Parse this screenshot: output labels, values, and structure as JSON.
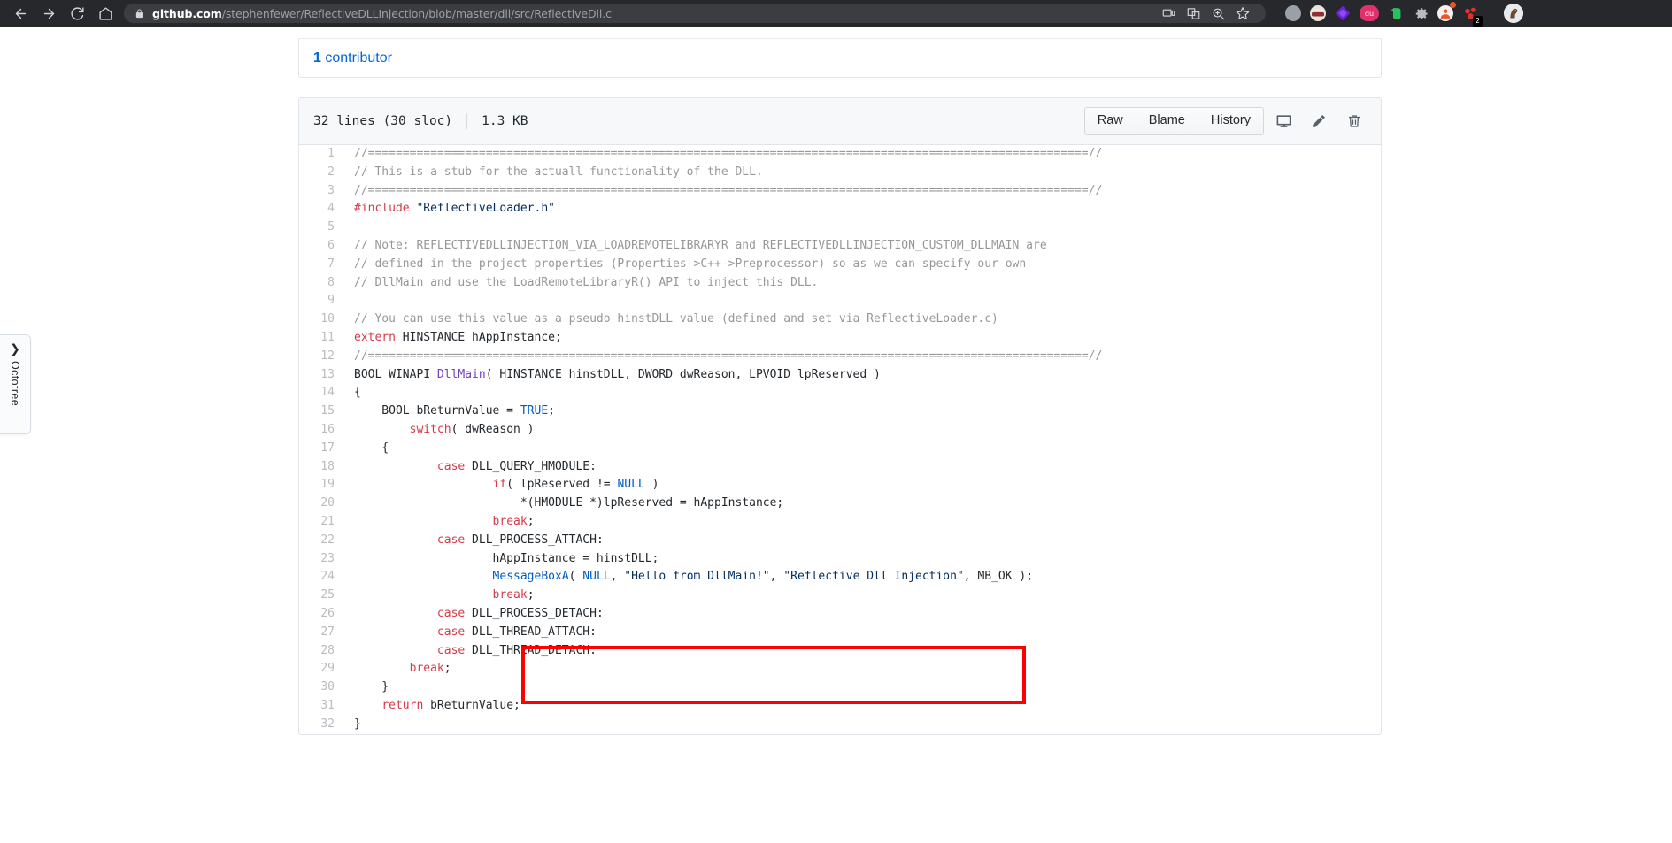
{
  "browser": {
    "nav": {
      "back": "back-arrow",
      "forward": "forward-arrow",
      "reload": "reload",
      "home": "home"
    },
    "omnibox": {
      "lock": "secure-lock",
      "host": "github.com",
      "path": "/stephenfewer/ReflectiveDLLInjection/blob/master/dll/src/ReflectiveDll.c",
      "full_url": "github.com/stephenfewer/ReflectiveDLLInjection/blob/master/dll/src/ReflectiveDll.c"
    },
    "omni_icons": [
      "cast-icon",
      "translate-icon",
      "zoom-icon",
      "bookmark-star-icon"
    ],
    "extensions": [
      {
        "name": "grey-circle-extension",
        "color": "#9aa0a6",
        "glyph": "○"
      },
      {
        "name": "incognito-mask-extension",
        "color": "#8b2d2d",
        "glyph": "◑"
      },
      {
        "name": "purple-diamond-extension",
        "color": "#7d2ae8",
        "glyph": "◆"
      },
      {
        "name": "du-pill-extension",
        "color": "#e2306c",
        "glyph": "du"
      },
      {
        "name": "evernote-extension",
        "color": "#2dbe60",
        "glyph": "◠"
      },
      {
        "name": "gear-extension",
        "color": "#8a8f94",
        "glyph": "⚙"
      },
      {
        "name": "contacts-extension",
        "color": "#e86a33",
        "glyph": "⚑",
        "badge": ""
      },
      {
        "name": "red-dots-extension",
        "color": "#d9342b",
        "glyph": "⁘",
        "badge": "2"
      }
    ],
    "profile_avatar": "horse-avatar"
  },
  "octotree": {
    "label": "Octotree",
    "chevron": "chevron-right-icon"
  },
  "contributors": {
    "count": "1",
    "label": " contributor"
  },
  "file": {
    "lines_info": "32 lines (30 sloc)",
    "size": "1.3 KB",
    "buttons": [
      "Raw",
      "Blame",
      "History"
    ],
    "icons": [
      "desktop-icon",
      "pencil-edit-icon",
      "trash-delete-icon"
    ]
  },
  "code": {
    "lines": [
      {
        "n": "1",
        "tokens": [
          {
            "t": "//========================================================================================================//",
            "c": "c"
          }
        ]
      },
      {
        "n": "2",
        "tokens": [
          {
            "t": "// This is a stub for the actuall functionality of the DLL.",
            "c": "c"
          }
        ]
      },
      {
        "n": "3",
        "tokens": [
          {
            "t": "//========================================================================================================//",
            "c": "c"
          }
        ]
      },
      {
        "n": "4",
        "tokens": [
          {
            "t": "#include",
            "c": "k"
          },
          {
            "t": " ",
            "c": ""
          },
          {
            "t": "\"ReflectiveLoader.h\"",
            "c": "s"
          }
        ]
      },
      {
        "n": "5",
        "tokens": [
          {
            "t": "",
            "c": ""
          }
        ]
      },
      {
        "n": "6",
        "tokens": [
          {
            "t": "// Note: REFLECTIVEDLLINJECTION_VIA_LOADREMOTELIBRARYR and REFLECTIVEDLLINJECTION_CUSTOM_DLLMAIN are",
            "c": "c"
          }
        ]
      },
      {
        "n": "7",
        "tokens": [
          {
            "t": "// defined in the project properties (Properties->C++->Preprocessor) so as we can specify our own",
            "c": "c"
          }
        ]
      },
      {
        "n": "8",
        "tokens": [
          {
            "t": "// DllMain and use the LoadRemoteLibraryR() API to inject this DLL.",
            "c": "c"
          }
        ]
      },
      {
        "n": "9",
        "tokens": [
          {
            "t": "",
            "c": ""
          }
        ]
      },
      {
        "n": "10",
        "tokens": [
          {
            "t": "// You can use this value as a pseudo hinstDLL value (defined and set via ReflectiveLoader.c)",
            "c": "c"
          }
        ]
      },
      {
        "n": "11",
        "tokens": [
          {
            "t": "extern",
            "c": "k"
          },
          {
            "t": " HINSTANCE hAppInstance;",
            "c": ""
          }
        ]
      },
      {
        "n": "12",
        "tokens": [
          {
            "t": "//========================================================================================================//",
            "c": "c"
          }
        ]
      },
      {
        "n": "13",
        "tokens": [
          {
            "t": "BOOL WINAPI ",
            "c": ""
          },
          {
            "t": "DllMain",
            "c": "fn"
          },
          {
            "t": "( HINSTANCE hinstDLL, DWORD dwReason, LPVOID lpReserved )",
            "c": ""
          }
        ]
      },
      {
        "n": "14",
        "tokens": [
          {
            "t": "{",
            "c": ""
          }
        ]
      },
      {
        "n": "15",
        "tokens": [
          {
            "t": "    BOOL bReturnValue = ",
            "c": ""
          },
          {
            "t": "TRUE",
            "c": "cn"
          },
          {
            "t": ";",
            "c": ""
          }
        ]
      },
      {
        "n": "16",
        "tokens": [
          {
            "t": "        ",
            "c": ""
          },
          {
            "t": "switch",
            "c": "k"
          },
          {
            "t": "( dwReason )",
            "c": ""
          }
        ]
      },
      {
        "n": "17",
        "tokens": [
          {
            "t": "    {",
            "c": ""
          }
        ]
      },
      {
        "n": "18",
        "tokens": [
          {
            "t": "            ",
            "c": ""
          },
          {
            "t": "case",
            "c": "k"
          },
          {
            "t": " DLL_QUERY_HMODULE:",
            "c": ""
          }
        ]
      },
      {
        "n": "19",
        "tokens": [
          {
            "t": "                    ",
            "c": ""
          },
          {
            "t": "if",
            "c": "k"
          },
          {
            "t": "( lpReserved != ",
            "c": ""
          },
          {
            "t": "NULL",
            "c": "cn"
          },
          {
            "t": " )",
            "c": ""
          }
        ]
      },
      {
        "n": "20",
        "tokens": [
          {
            "t": "                        *(HMODULE *)lpReserved = hAppInstance;",
            "c": ""
          }
        ]
      },
      {
        "n": "21",
        "tokens": [
          {
            "t": "                    ",
            "c": ""
          },
          {
            "t": "break",
            "c": "k"
          },
          {
            "t": ";",
            "c": ""
          }
        ]
      },
      {
        "n": "22",
        "tokens": [
          {
            "t": "            ",
            "c": ""
          },
          {
            "t": "case",
            "c": "k"
          },
          {
            "t": " DLL_PROCESS_ATTACH:",
            "c": ""
          }
        ]
      },
      {
        "n": "23",
        "tokens": [
          {
            "t": "                    hAppInstance = hinstDLL;",
            "c": ""
          }
        ]
      },
      {
        "n": "24",
        "tokens": [
          {
            "t": "                    ",
            "c": ""
          },
          {
            "t": "MessageBoxA",
            "c": "bl"
          },
          {
            "t": "( ",
            "c": ""
          },
          {
            "t": "NULL",
            "c": "cn"
          },
          {
            "t": ", ",
            "c": ""
          },
          {
            "t": "\"Hello from DllMain!\"",
            "c": "s"
          },
          {
            "t": ", ",
            "c": ""
          },
          {
            "t": "\"Reflective Dll Injection\"",
            "c": "s"
          },
          {
            "t": ", MB_OK );",
            "c": ""
          }
        ]
      },
      {
        "n": "25",
        "tokens": [
          {
            "t": "                    ",
            "c": ""
          },
          {
            "t": "break",
            "c": "k"
          },
          {
            "t": ";",
            "c": ""
          }
        ]
      },
      {
        "n": "26",
        "tokens": [
          {
            "t": "            ",
            "c": ""
          },
          {
            "t": "case",
            "c": "k"
          },
          {
            "t": " DLL_PROCESS_DETACH:",
            "c": ""
          }
        ]
      },
      {
        "n": "27",
        "tokens": [
          {
            "t": "            ",
            "c": ""
          },
          {
            "t": "case",
            "c": "k"
          },
          {
            "t": " DLL_THREAD_ATTACH:",
            "c": ""
          }
        ]
      },
      {
        "n": "28",
        "tokens": [
          {
            "t": "            ",
            "c": ""
          },
          {
            "t": "case",
            "c": "k"
          },
          {
            "t": " DLL_THREAD_DETACH:",
            "c": ""
          }
        ]
      },
      {
        "n": "29",
        "tokens": [
          {
            "t": "        ",
            "c": ""
          },
          {
            "t": "break",
            "c": "k"
          },
          {
            "t": ";",
            "c": ""
          }
        ]
      },
      {
        "n": "30",
        "tokens": [
          {
            "t": "    }",
            "c": ""
          }
        ]
      },
      {
        "n": "31",
        "tokens": [
          {
            "t": "    ",
            "c": ""
          },
          {
            "t": "return",
            "c": "k"
          },
          {
            "t": " bReturnValue;",
            "c": ""
          }
        ]
      },
      {
        "n": "32",
        "tokens": [
          {
            "t": "}",
            "c": ""
          }
        ]
      }
    ]
  },
  "annotation": {
    "name": "red-highlight-box",
    "color": "#fe0000",
    "covers_lines": [
      "23",
      "24",
      "25"
    ]
  }
}
